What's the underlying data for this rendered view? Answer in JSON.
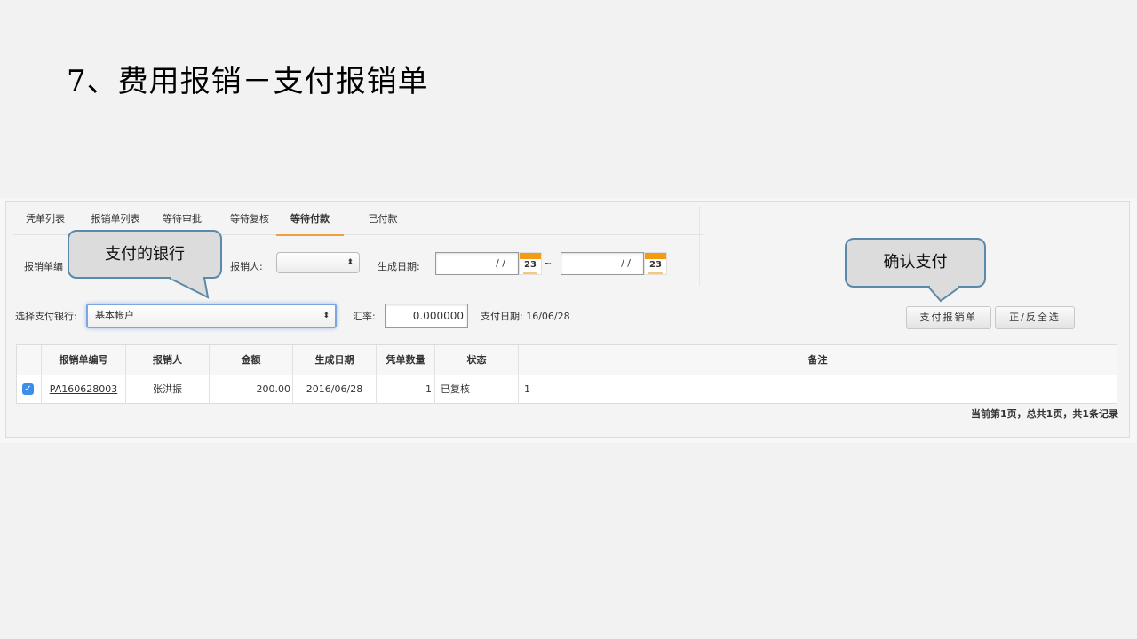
{
  "slide": {
    "title": "7、费用报销－支付报销单"
  },
  "tabs": [
    {
      "label": "凭单列表"
    },
    {
      "label": "报销单列表"
    },
    {
      "label": "等待审批"
    },
    {
      "label": "等待复核"
    },
    {
      "label": "等待付款",
      "active": true
    },
    {
      "label": "已付款"
    }
  ],
  "filters": {
    "expense_no_label": "报销单编",
    "reimburser_label": "报销人:",
    "reimburser_value": "",
    "created_date_label": "生成日期:",
    "date_from": "/ /",
    "date_to": "/ /",
    "date_separator": "~",
    "calendar_day": "23"
  },
  "payment": {
    "bank_label": "选择支付银行:",
    "bank_value": "基本帐户",
    "rate_label": "汇率:",
    "rate_value": "0.000000",
    "pay_date_label": "支付日期:",
    "pay_date_value": "16/06/28"
  },
  "buttons": {
    "pay": "支付报销单",
    "toggle_select": "正/反全选"
  },
  "table": {
    "headers": [
      "报销单编号",
      "报销人",
      "金额",
      "生成日期",
      "凭单数量",
      "状态",
      "备注"
    ],
    "rows": [
      {
        "checked": true,
        "no": "PA160628003",
        "person": "张洪振",
        "amount": "200.00",
        "date": "2016/06/28",
        "count": "1",
        "status": "已复核",
        "note": "1"
      }
    ]
  },
  "pager": "当前第1页，总共1页，共1条记录",
  "callouts": {
    "bank": "支付的银行",
    "confirm": "确认支付"
  },
  "colors": {
    "accent_tab": "#f0a040",
    "callout_border": "#5b8aa8",
    "checkbox": "#3d8ee8"
  }
}
